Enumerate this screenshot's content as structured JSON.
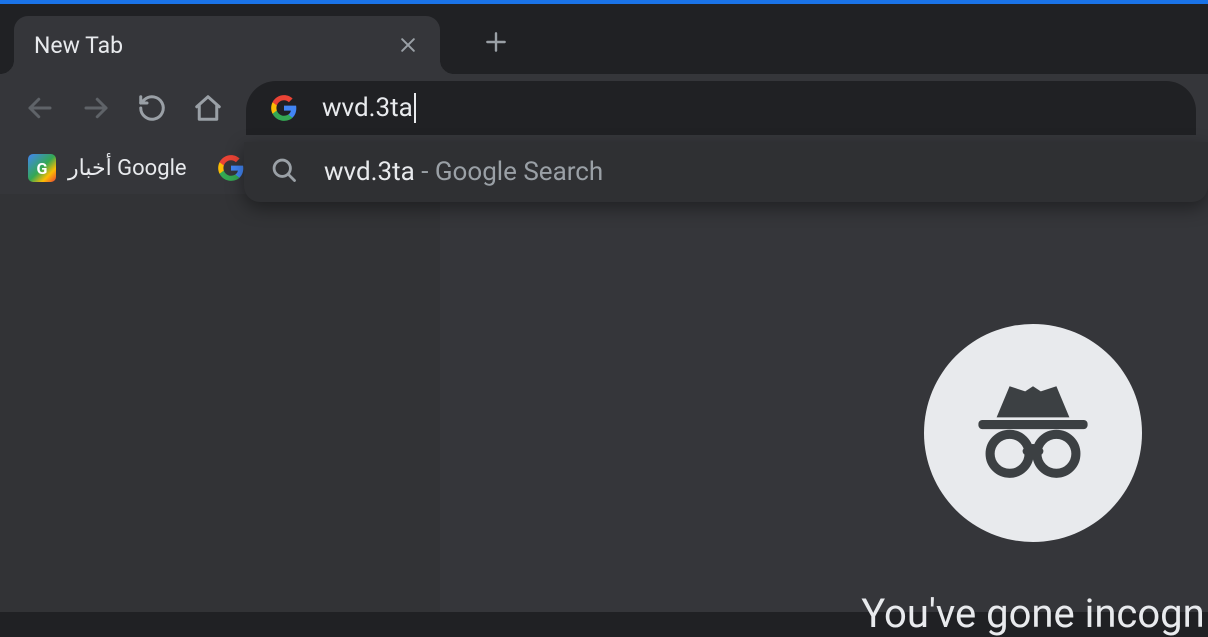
{
  "tabs": {
    "active": {
      "title": "New Tab"
    }
  },
  "omnibox": {
    "value": "wvd.3ta"
  },
  "suggestion": {
    "query": "wvd.3ta",
    "suffix": " - Google Search"
  },
  "bookmarks": [
    {
      "label": "أخبار Google"
    }
  ],
  "incognito": {
    "heading": "You've gone incogn"
  }
}
